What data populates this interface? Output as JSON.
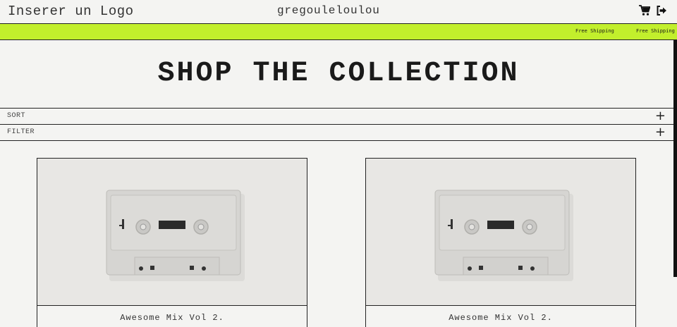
{
  "header": {
    "logo_text": "Inserer un Logo",
    "site_name": "gregouleloulou",
    "icons": [
      "cart-icon",
      "logout-icon"
    ]
  },
  "marquee": {
    "items": [
      "Free Shipping",
      "Free Shipping"
    ],
    "background": "#c2ef2c"
  },
  "page": {
    "title": "SHOP THE COLLECTION"
  },
  "controls": {
    "sort_label": "SORT",
    "filter_label": "FILTER",
    "expand_symbol": "+"
  },
  "products": [
    {
      "name": "Awesome Mix Vol 2.",
      "image": "cassette-tape"
    },
    {
      "name": "Awesome Mix Vol 2.",
      "image": "cassette-tape"
    }
  ],
  "colors": {
    "accent": "#c2ef2c",
    "background": "#f4f4f2",
    "text": "#222222"
  }
}
